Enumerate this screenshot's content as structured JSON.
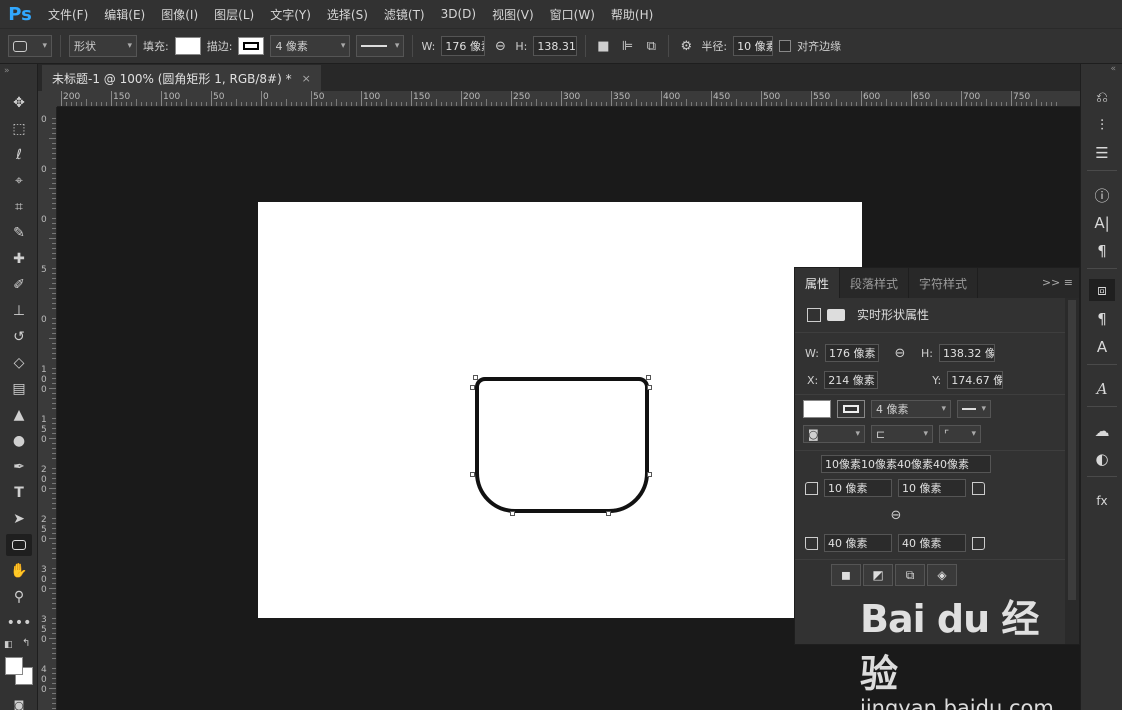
{
  "app": {
    "logo": "Ps"
  },
  "menu": [
    "文件(F)",
    "编辑(E)",
    "图像(I)",
    "图层(L)",
    "文字(Y)",
    "选择(S)",
    "滤镜(T)",
    "3D(D)",
    "视图(V)",
    "窗口(W)",
    "帮助(H)"
  ],
  "options": {
    "mode": "形状",
    "fill_label": "填充:",
    "stroke_label": "描边:",
    "stroke_width": "4 像素",
    "w_label": "W:",
    "w_value": "176 像素",
    "h_label": "H:",
    "h_value": "138.31 像",
    "radius_label": "半径:",
    "radius_value": "10 像素",
    "align_edges": "对齐边缘"
  },
  "document_tab": {
    "title": "未标题-1 @ 100% (圆角矩形 1, RGB/8#) *",
    "close": "×"
  },
  "ruler": {
    "h_ticks": [
      "200",
      "150",
      "100",
      "50",
      "0",
      "50",
      "100",
      "150",
      "200",
      "250",
      "300",
      "350",
      "400",
      "450",
      "500",
      "550",
      "600",
      "650",
      "700",
      "750"
    ],
    "v_ticks": [
      "0",
      "0",
      "0",
      "5",
      "0",
      "1 0 0",
      "1 5 0",
      "2 0 0",
      "2 5 0",
      "3 0 0",
      "3 5 0",
      "4 0 0"
    ]
  },
  "properties": {
    "tabs": [
      "属性",
      "段落样式",
      "字符样式"
    ],
    "menu": ">> ≡",
    "section_title": "实时形状属性",
    "w_label": "W:",
    "w_value": "176 像素",
    "h_label": "H:",
    "h_value": "138.32 像",
    "x_label": "X:",
    "x_value": "214 像素",
    "y_label": "Y:",
    "y_value": "174.67 像",
    "stroke_width": "4 像素",
    "radius_summary": "10像素10像素40像素40像素",
    "tl_radius": "10 像素",
    "tr_radius": "10 像素",
    "bl_radius": "40 像素",
    "br_radius": "40 像素"
  },
  "watermark": {
    "main": "Bai du 经验",
    "url": "jingyan.baidu.com"
  }
}
